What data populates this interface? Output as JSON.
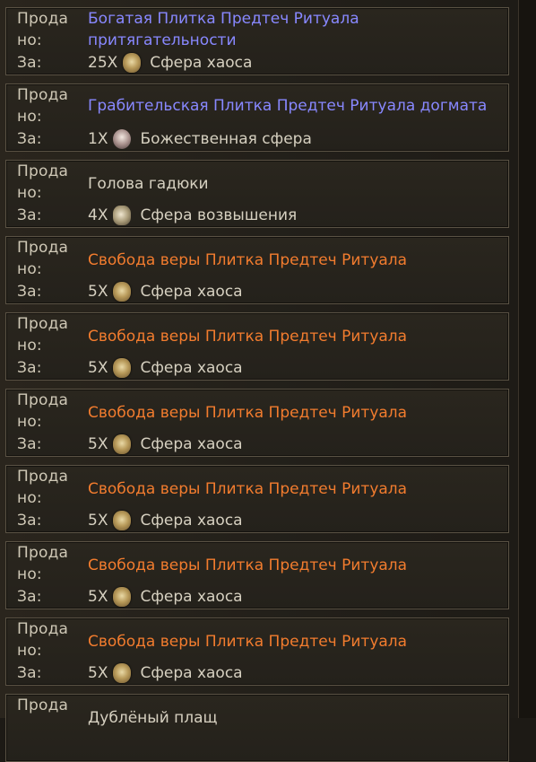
{
  "labels": {
    "sold_1": "Прода",
    "sold_2": "но:",
    "for": "За:"
  },
  "rows": [
    {
      "item": "Богатая Плитка Предтеч Ритуала притягательности",
      "qty": "25X",
      "currency": "Сфера хаоса"
    },
    {
      "item": "Грабительская Плитка Предтеч Ритуала догмата",
      "qty": "1X",
      "currency": "Божественная сфера"
    },
    {
      "item": "Голова гадюки",
      "qty": "4X",
      "currency": "Сфера возвышения"
    },
    {
      "item": "Свобода веры Плитка Предтеч Ритуала",
      "qty": "5X",
      "currency": "Сфера хаоса"
    },
    {
      "item": "Свобода веры Плитка Предтеч Ритуала",
      "qty": "5X",
      "currency": "Сфера хаоса"
    },
    {
      "item": "Свобода веры Плитка Предтеч Ритуала",
      "qty": "5X",
      "currency": "Сфера хаоса"
    },
    {
      "item": "Свобода веры Плитка Предтеч Ритуала",
      "qty": "5X",
      "currency": "Сфера хаоса"
    },
    {
      "item": "Свобода веры Плитка Предтеч Ритуала",
      "qty": "5X",
      "currency": "Сфера хаоса"
    },
    {
      "item": "Свобода веры Плитка Предтеч Ритуала",
      "qty": "5X",
      "currency": "Сфера хаоса"
    },
    {
      "item": "Дублёный плащ",
      "qty": "",
      "currency": ""
    }
  ],
  "colors": {
    "magic": "#8888ff",
    "unique": "#f27c2e",
    "normal": "#d6d0c0",
    "label": "#cfc8b6"
  },
  "icons": {
    "chaos": "chaos-orb-icon",
    "divine": "divine-orb-icon",
    "exalted": "exalted-orb-icon"
  }
}
